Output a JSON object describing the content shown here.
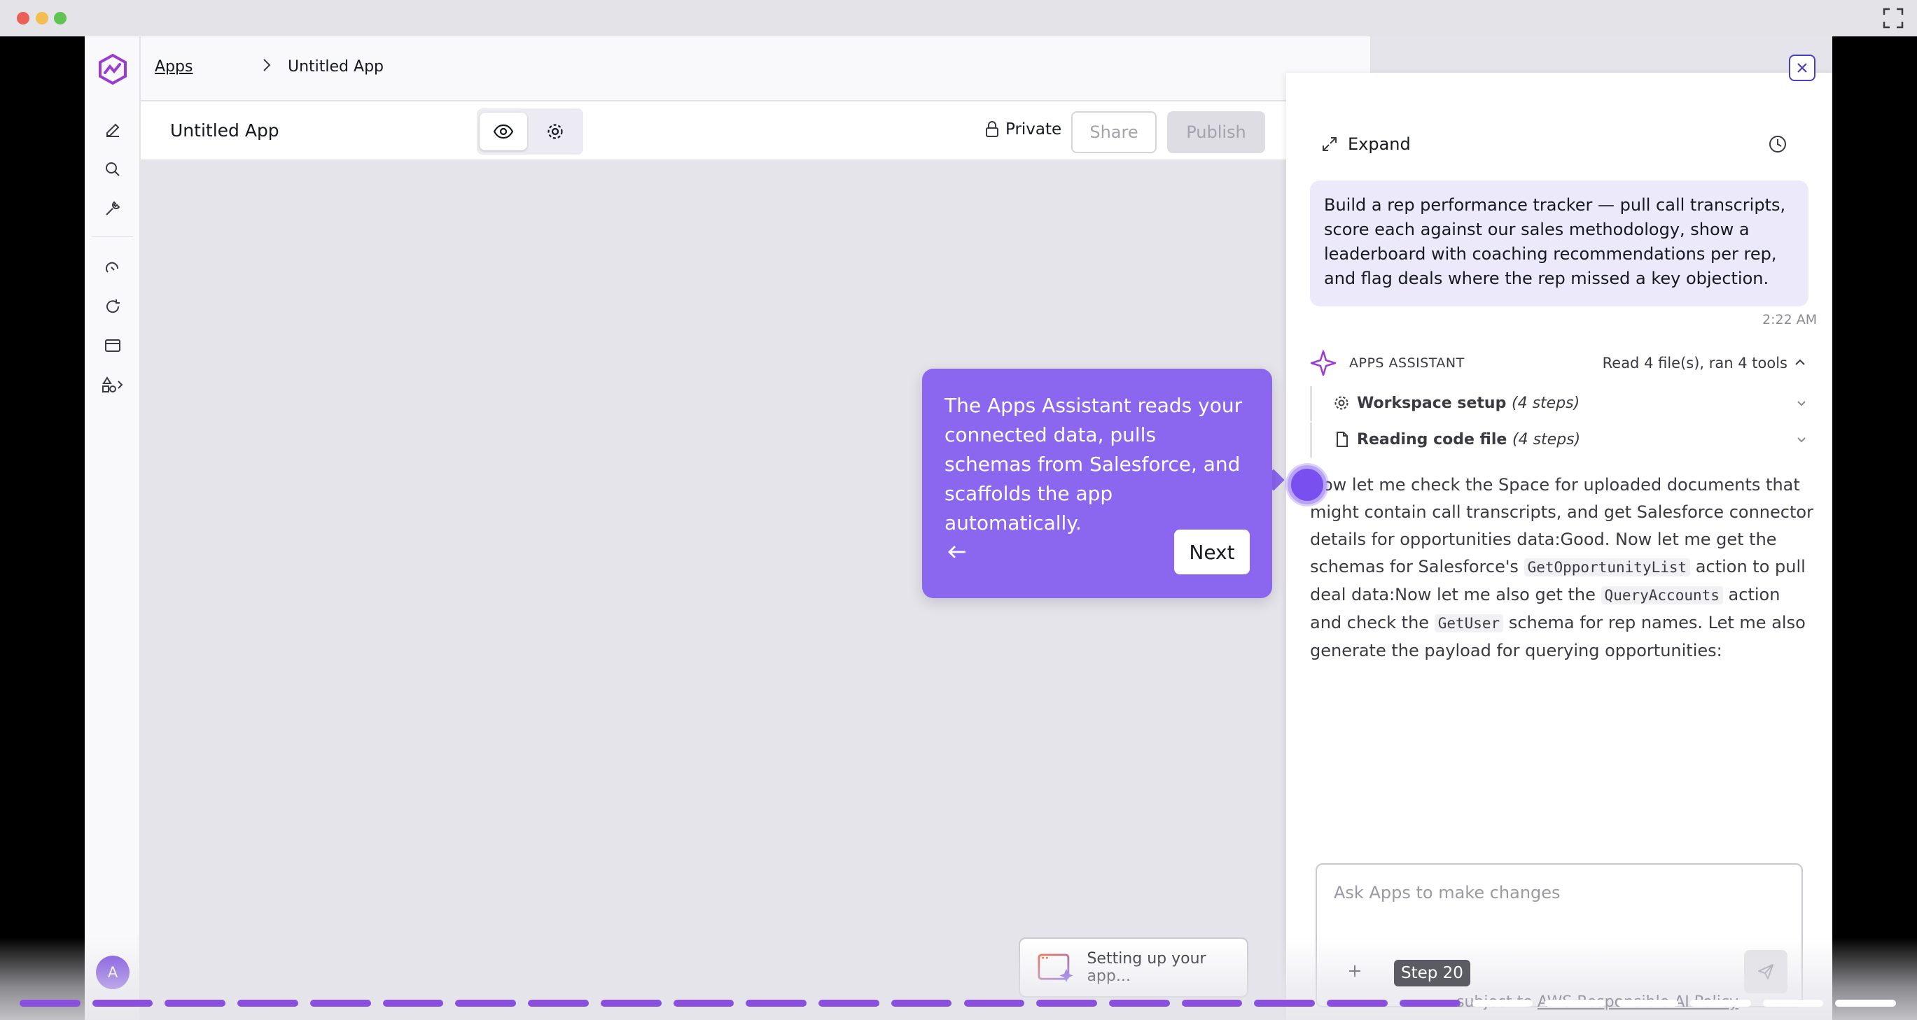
{
  "window": {
    "controls": [
      "close",
      "minimize",
      "zoom"
    ]
  },
  "breadcrumb": {
    "root": "Apps",
    "current": "Untitled App"
  },
  "toolbar": {
    "app_name": "Untitled App",
    "privacy_label": "Private",
    "share_label": "Share",
    "publish_label": "Publish"
  },
  "nav": {
    "icons": [
      "pencil-icon",
      "search-icon",
      "tools-icon",
      "ai-edit-icon",
      "chat-refresh-icon",
      "app-window-icon",
      "shapes-icon"
    ],
    "avatar_initial": "A"
  },
  "panel": {
    "expand_label": "Expand",
    "user_message": "Build a rep performance tracker — pull call transcripts, score each against our sales methodology, show a leaderboard with coaching recommendations per rep, and flag deals where the rep missed a key objection.",
    "message_time": "2:22 AM",
    "assistant_name": "APPS ASSISTANT",
    "assistant_summary": "Read 4 file(s), ran 4 tools",
    "steps": [
      {
        "title": "Workspace setup",
        "detail": "(4 steps)"
      },
      {
        "title": "Reading code file",
        "detail": "(4 steps)"
      }
    ],
    "response": {
      "p1": "Now let me check the Space for uploaded documents that might contain call transcripts, and get Salesforce connector details for opportunities data:Good. Now let me get the schemas for Salesforce's ",
      "code1": "GetOpportunityList",
      "p2": " action to pull deal data:Now let me also get the ",
      "code2": "QueryAccounts",
      "p3": " action and check the ",
      "code3": "GetUser",
      "p4": " schema for rep names. Let me also generate the payload for querying opportunities:"
    },
    "composer_placeholder": "Ask Apps to make changes"
  },
  "tour": {
    "text": "The Apps Assistant reads your connected data, pulls schemas from Salesforce, and scaffolds the app automatically.",
    "next_label": "Next"
  },
  "toast": {
    "text": "Setting up your app..."
  },
  "progress": {
    "step_label": "Step 20",
    "total_segments": 26,
    "current_segment": 20,
    "policy_prefix": "subject to ",
    "policy_link": "AWS Responsible AI Policy"
  },
  "colors": {
    "accent": "#8b66ef",
    "brand": "#7847e0"
  }
}
